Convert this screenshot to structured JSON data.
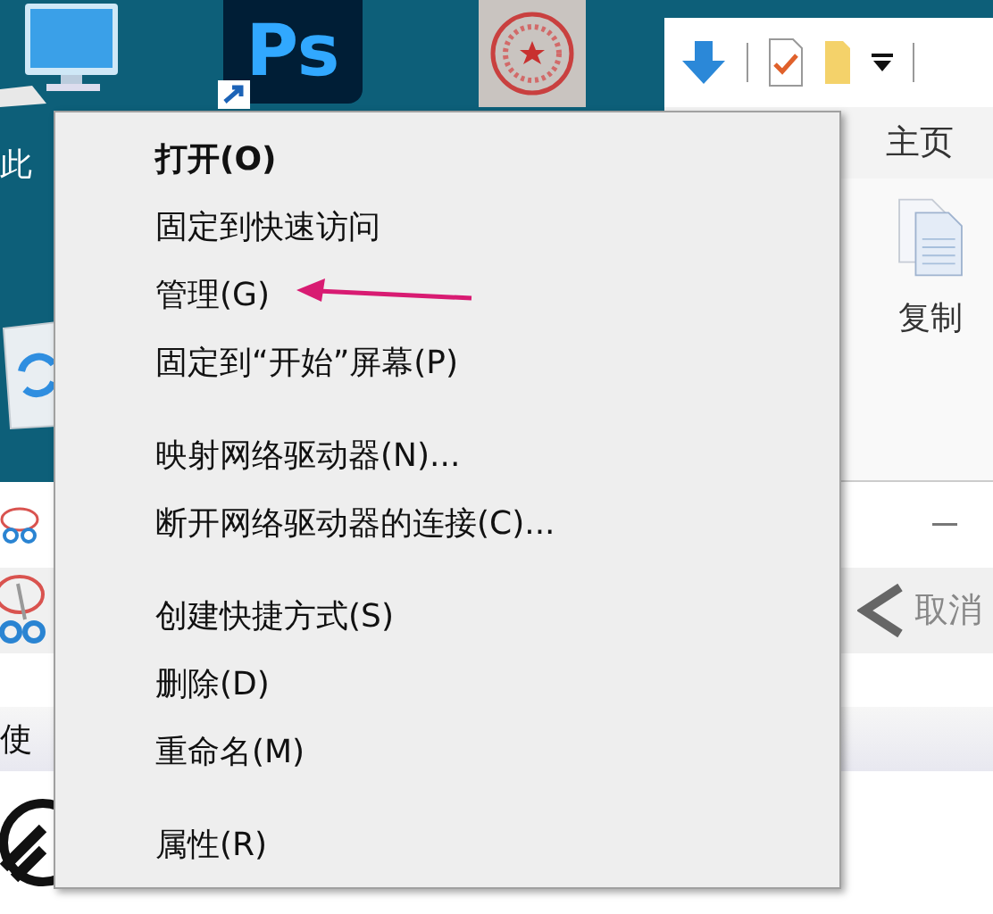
{
  "desktop": {
    "icons": [
      {
        "kind": "computer",
        "label": "此"
      },
      {
        "kind": "photoshop",
        "text": "Ps"
      },
      {
        "kind": "stamp"
      },
      {
        "kind": "recycle"
      }
    ]
  },
  "explorer": {
    "tab": "主页",
    "ribbon_button": "复制"
  },
  "snipping_tool": {
    "cancel": "取消",
    "hint": "使"
  },
  "context_menu": {
    "groups": [
      {
        "items": [
          {
            "label": "打开(O)",
            "default": true
          },
          {
            "label": "固定到快速访问",
            "default": false
          },
          {
            "label": "管理(G)",
            "default": false
          },
          {
            "label": "固定到“开始”屏幕(P)",
            "default": false
          }
        ]
      },
      {
        "items": [
          {
            "label": "映射网络驱动器(N)...",
            "default": false
          },
          {
            "label": "断开网络驱动器的连接(C)...",
            "default": false
          }
        ]
      },
      {
        "items": [
          {
            "label": "创建快捷方式(S)",
            "default": false
          },
          {
            "label": "删除(D)",
            "default": false
          },
          {
            "label": "重命名(M)",
            "default": false
          }
        ]
      },
      {
        "items": [
          {
            "label": "属性(R)",
            "default": false
          }
        ]
      }
    ]
  },
  "annotation": {
    "kind": "arrow"
  }
}
